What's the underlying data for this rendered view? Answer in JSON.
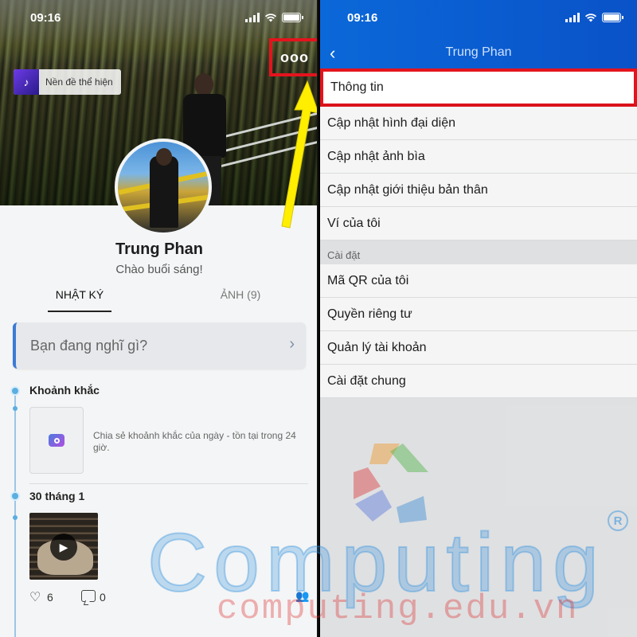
{
  "status_bar": {
    "time": "09:16"
  },
  "left": {
    "background_chip_label": "Nền đề thể hiện",
    "more_button_label": "ooo",
    "profile": {
      "name": "Trung Phan",
      "greeting": "Chào buổi sáng!"
    },
    "tabs": [
      {
        "label": "NHẬT KÝ"
      },
      {
        "label": "ẢNH (9)"
      }
    ],
    "composer": {
      "placeholder": "Bạn đang nghĩ gì?"
    },
    "moments": {
      "title": "Khoảnh khắc",
      "description": "Chia sẻ khoảnh khắc của ngày - tồn tại trong 24 giờ."
    },
    "post": {
      "date": "30 tháng 1",
      "likes": "6",
      "comments": "0"
    }
  },
  "right": {
    "title": "Trung Phan",
    "menu": [
      {
        "label": "Thông tin"
      },
      {
        "label": "Cập nhật hình đại diện"
      },
      {
        "label": "Cập nhật ảnh bìa"
      },
      {
        "label": "Cập nhật giới thiệu bản thân"
      },
      {
        "label": "Ví của tôi"
      }
    ],
    "settings_section": {
      "label": "Cài đặt",
      "items": [
        {
          "label": "Mã QR của tôi"
        },
        {
          "label": "Quyền riêng tư"
        },
        {
          "label": "Quản lý tài khoản"
        },
        {
          "label": "Cài đặt chung"
        }
      ]
    }
  },
  "watermark": {
    "brand": "Computing",
    "registered": "R",
    "url": "computing.edu.vn"
  },
  "colors": {
    "header_blue": "#0b68d8",
    "highlight_red": "#e3141d",
    "arrow_yellow": "#ffee00",
    "accent_blue": "#3a7bd5"
  }
}
